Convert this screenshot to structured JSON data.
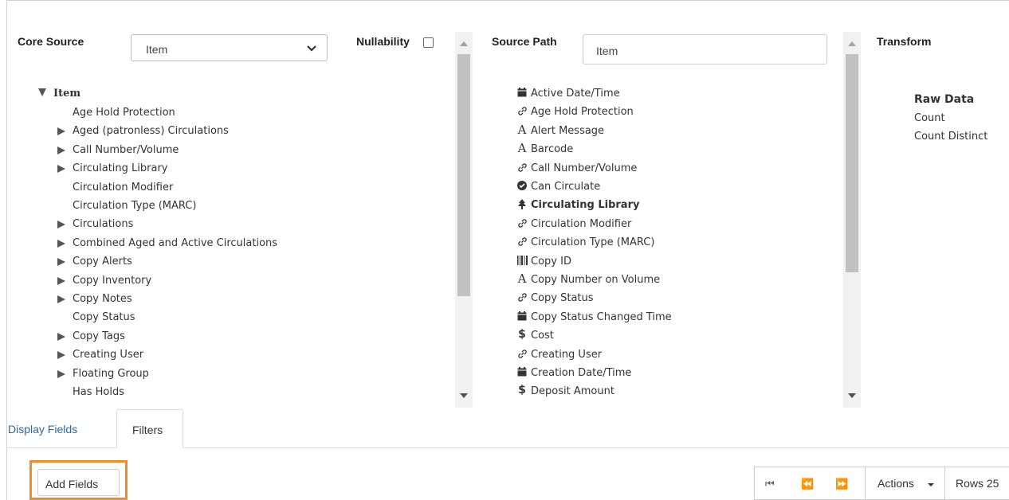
{
  "core_source": {
    "label": "Core Source",
    "selected": "Item"
  },
  "nullability": {
    "label": "Nullability",
    "checked": false
  },
  "source_path": {
    "label": "Source Path",
    "value": "Item"
  },
  "transform": {
    "label": "Transform",
    "items": [
      "Raw Data",
      "Count",
      "Count Distinct"
    ]
  },
  "tree": {
    "root": "Item",
    "items": [
      {
        "label": "Age Hold Protection",
        "expandable": false
      },
      {
        "label": "Aged (patronless) Circulations",
        "expandable": true
      },
      {
        "label": "Call Number/Volume",
        "expandable": true
      },
      {
        "label": "Circulating Library",
        "expandable": true
      },
      {
        "label": "Circulation Modifier",
        "expandable": false
      },
      {
        "label": "Circulation Type (MARC)",
        "expandable": false
      },
      {
        "label": "Circulations",
        "expandable": true
      },
      {
        "label": "Combined Aged and Active Circulations",
        "expandable": true
      },
      {
        "label": "Copy Alerts",
        "expandable": true
      },
      {
        "label": "Copy Inventory",
        "expandable": true
      },
      {
        "label": "Copy Notes",
        "expandable": true
      },
      {
        "label": "Copy Status",
        "expandable": false
      },
      {
        "label": "Copy Tags",
        "expandable": true
      },
      {
        "label": "Creating User",
        "expandable": true
      },
      {
        "label": "Floating Group",
        "expandable": true
      },
      {
        "label": "Has Holds",
        "expandable": false
      }
    ]
  },
  "fields": [
    {
      "icon": "calendar-icon",
      "label": "Active Date/Time"
    },
    {
      "icon": "link-icon",
      "label": "Age Hold Protection"
    },
    {
      "icon": "text-icon",
      "label": "Alert Message"
    },
    {
      "icon": "text-icon",
      "label": "Barcode"
    },
    {
      "icon": "link-icon",
      "label": "Call Number/Volume"
    },
    {
      "icon": "check-circle-icon",
      "label": "Can Circulate"
    },
    {
      "icon": "tree-icon",
      "label": "Circulating Library",
      "bold": true
    },
    {
      "icon": "link-icon",
      "label": "Circulation Modifier"
    },
    {
      "icon": "link-icon",
      "label": "Circulation Type (MARC)"
    },
    {
      "icon": "barcode-icon",
      "label": "Copy ID"
    },
    {
      "icon": "text-icon",
      "label": "Copy Number on Volume"
    },
    {
      "icon": "link-icon",
      "label": "Copy Status"
    },
    {
      "icon": "calendar-icon",
      "label": "Copy Status Changed Time"
    },
    {
      "icon": "dollar-icon",
      "label": "Cost"
    },
    {
      "icon": "link-icon",
      "label": "Creating User"
    },
    {
      "icon": "calendar-icon",
      "label": "Creation Date/Time"
    },
    {
      "icon": "dollar-icon",
      "label": "Deposit Amount"
    }
  ],
  "tabs": {
    "display_fields": "Display Fields",
    "filters": "Filters",
    "active": "filters"
  },
  "add_fields_label": "Add Fields",
  "actions_label": "Actions",
  "rows_label": "Rows 25",
  "link_color": "#2a6aa8",
  "highlight_color": "#f08c2a"
}
